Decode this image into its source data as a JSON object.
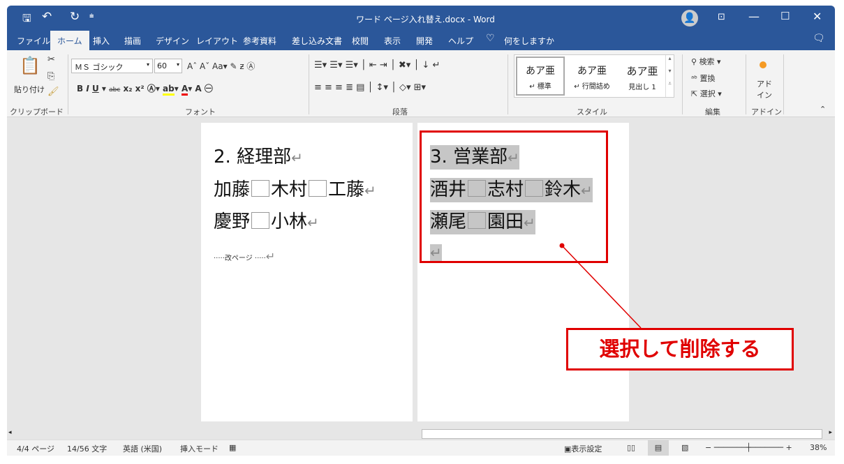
{
  "title": "ワード ページ入れ替え.docx  -  Word",
  "qat": {
    "save": "save-icon",
    "undo": "↶",
    "redo": "↻"
  },
  "tabs": [
    "ファイル",
    "ホーム",
    "挿入",
    "描画",
    "デザイン",
    "レイアウト",
    "参考資料",
    "差し込み文書",
    "校閲",
    "表示",
    "開発",
    "ヘルプ"
  ],
  "tell_me": "何をしますか",
  "ribbon": {
    "paste": "貼り付け",
    "clipboard": "クリップボード",
    "font_name": "ＭＳ ゴシック",
    "font_size": "60",
    "font": "フォント",
    "paragraph": "段落",
    "styles": [
      {
        "sample": "あア亜",
        "name": "↵ 標準"
      },
      {
        "sample": "あア亜",
        "name": "↵ 行間詰め"
      },
      {
        "sample": "あア亜",
        "name": "見出し 1"
      }
    ],
    "style": "スタイル",
    "find": "検索",
    "replace": "置換",
    "select": "選択",
    "editing": "編集",
    "addin": "アド\nイン",
    "addin_group": "アドイン"
  },
  "page1": {
    "lines": [
      "2. 経理部",
      "加藤",
      "木村",
      "工藤",
      "慶野",
      "小林"
    ],
    "page_break": "改ページ"
  },
  "page2": {
    "lines": [
      "3. 営業部",
      "酒井",
      "志村",
      "鈴木",
      "瀬尾",
      "園田"
    ]
  },
  "callout": "選択して削除する",
  "accent": "#e00000",
  "status": {
    "page": "4/4 ページ",
    "words": "14/56 文字",
    "lang": "英語 (米国)",
    "mode": "挿入モード",
    "display": "表示設定",
    "zoom": "38%"
  }
}
